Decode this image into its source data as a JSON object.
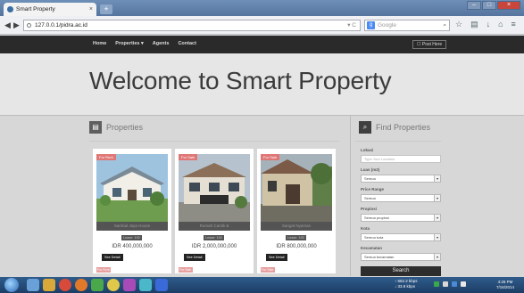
{
  "browser": {
    "tab_title": "Smart Property",
    "url": "127.0.0.1/pidra.ac.id",
    "search_engine_label": "g",
    "search_placeholder": "Google"
  },
  "site": {
    "menu": [
      "Home",
      "Properties",
      "Agents",
      "Contact"
    ],
    "post_button": "Post Here",
    "hero_title": "Welcome to Smart Property",
    "properties_heading": "Properties",
    "find_heading": "Find Properties"
  },
  "cards": [
    {
      "badge": "For Rent",
      "caption": "Sambal Jaya House",
      "chip": "Lease: 100",
      "price": "IDR 400,000,000",
      "button": "See Detail"
    },
    {
      "badge": "For Sale",
      "caption": "Rumah Cantik &",
      "chip": "Lease: 100",
      "price": "IDR 2,000,000,000",
      "button": "See Detail"
    },
    {
      "badge": "For Sale",
      "caption": "Sangat Nyaman",
      "chip": "Lease: 100",
      "price": "IDR 800,000,000",
      "button": "See Detail"
    }
  ],
  "mini_badges": [
    "For Rent",
    "For Sale",
    "For Sale"
  ],
  "search": {
    "lokasi_label": "Lokasi",
    "lokasi_placeholder": "Type Your Location",
    "luas_label": "Luas (m2)",
    "luas_value": "Semua",
    "price_label": "Price Range",
    "price_value": "Semua",
    "propinsi_label": "Propinsi",
    "propinsi_value": "Semua propinsi",
    "kota_label": "Kota",
    "kota_value": "Semua kota",
    "kec_label": "Kecamatan",
    "kec_value": "Semua kecamatan",
    "button": "Search"
  },
  "taskbar": {
    "net_up": "662.2 kbps",
    "net_down": "33.8 kbps",
    "time": "4:26 PM",
    "date": "7/16/2014"
  }
}
